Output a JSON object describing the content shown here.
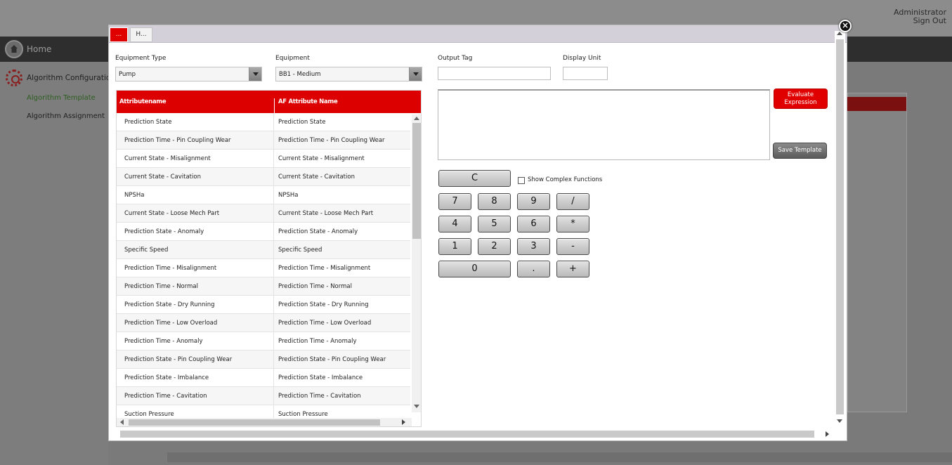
{
  "app": {
    "user": "Administrator",
    "sign_out": "Sign Out",
    "home_label": "Home",
    "sidebar": {
      "title": "Algorithm Configuration",
      "items": [
        {
          "label": "Algorithm Template",
          "active": true
        },
        {
          "label": "Algorithm Assignment",
          "active": false
        }
      ]
    }
  },
  "modal": {
    "tabs": [
      {
        "label": "..."
      },
      {
        "label": "H..."
      }
    ],
    "close_icon": "close-icon",
    "equipment_type": {
      "label": "Equipment Type",
      "value": "Pump"
    },
    "equipment": {
      "label": "Equipment",
      "value": "BB1 - Medium"
    },
    "output_tag": {
      "label": "Output Tag",
      "value": ""
    },
    "display_unit": {
      "label": "Display Unit",
      "value": ""
    },
    "grid": {
      "columns": [
        "Attributename",
        "AF Attribute Name"
      ],
      "rows": [
        [
          "Prediction State",
          "Prediction State"
        ],
        [
          "Prediction Time - Pin Coupling Wear",
          "Prediction Time - Pin Coupling Wear"
        ],
        [
          "Current State - Misalignment",
          "Current State - Misalignment"
        ],
        [
          "Current State - Cavitation",
          "Current State - Cavitation"
        ],
        [
          "NPSHa",
          "NPSHa"
        ],
        [
          "Current State - Loose Mech Part",
          "Current State - Loose Mech Part"
        ],
        [
          "Prediction State - Anomaly",
          "Prediction State - Anomaly"
        ],
        [
          "Specific Speed",
          "Specific Speed"
        ],
        [
          "Prediction Time - Misalignment",
          "Prediction Time - Misalignment"
        ],
        [
          "Prediction Time - Normal",
          "Prediction Time - Normal"
        ],
        [
          "Prediction State - Dry Running",
          "Prediction State - Dry Running"
        ],
        [
          "Prediction Time - Low Overload",
          "Prediction Time - Low Overload"
        ],
        [
          "Prediction Time - Anomaly",
          "Prediction Time - Anomaly"
        ],
        [
          "Prediction State - Pin Coupling Wear",
          "Prediction State - Pin Coupling Wear"
        ],
        [
          "Prediction State - Imbalance",
          "Prediction State - Imbalance"
        ],
        [
          "Prediction Time - Cavitation",
          "Prediction Time - Cavitation"
        ],
        [
          "Suction Pressure",
          "Suction Pressure"
        ]
      ]
    },
    "expression": "",
    "evaluate_button": "Evaluate Expression",
    "save_button": "Save Template",
    "show_complex": {
      "label": "Show Complex Functions",
      "checked": false
    },
    "keypad": {
      "clear": "C",
      "keys": [
        "7",
        "8",
        "9",
        "/",
        "4",
        "5",
        "6",
        "*",
        "1",
        "2",
        "3",
        "-",
        "0",
        ".",
        "+"
      ]
    },
    "colors": {
      "accent": "#dd0000",
      "header_text": "#ffffff",
      "overlay": "#7a7a7a"
    }
  }
}
